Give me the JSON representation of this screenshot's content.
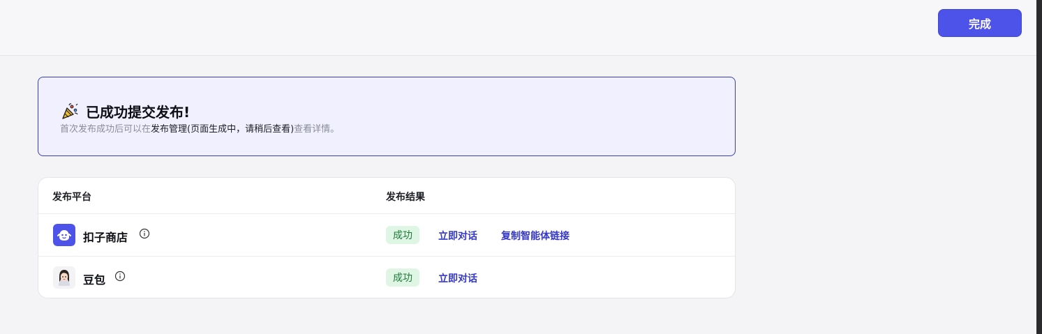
{
  "header": {
    "done_label": "完成"
  },
  "success": {
    "title": "已成功提交发布!",
    "desc_prefix": "首次发布成功后可以在",
    "desc_link": "发布管理(页面生成中，请稍后查看)",
    "desc_suffix": "查看详情。"
  },
  "table": {
    "columns": [
      "发布平台",
      "发布结果"
    ],
    "rows": [
      {
        "platform": "扣子商店",
        "status": "成功",
        "actions": [
          "立即对话",
          "复制智能体链接"
        ]
      },
      {
        "platform": "豆包",
        "status": "成功",
        "actions": [
          "立即对话"
        ]
      }
    ]
  },
  "colors": {
    "accent": "#4d53e8",
    "link": "#3438c8",
    "success_bg": "#dff6e4"
  }
}
